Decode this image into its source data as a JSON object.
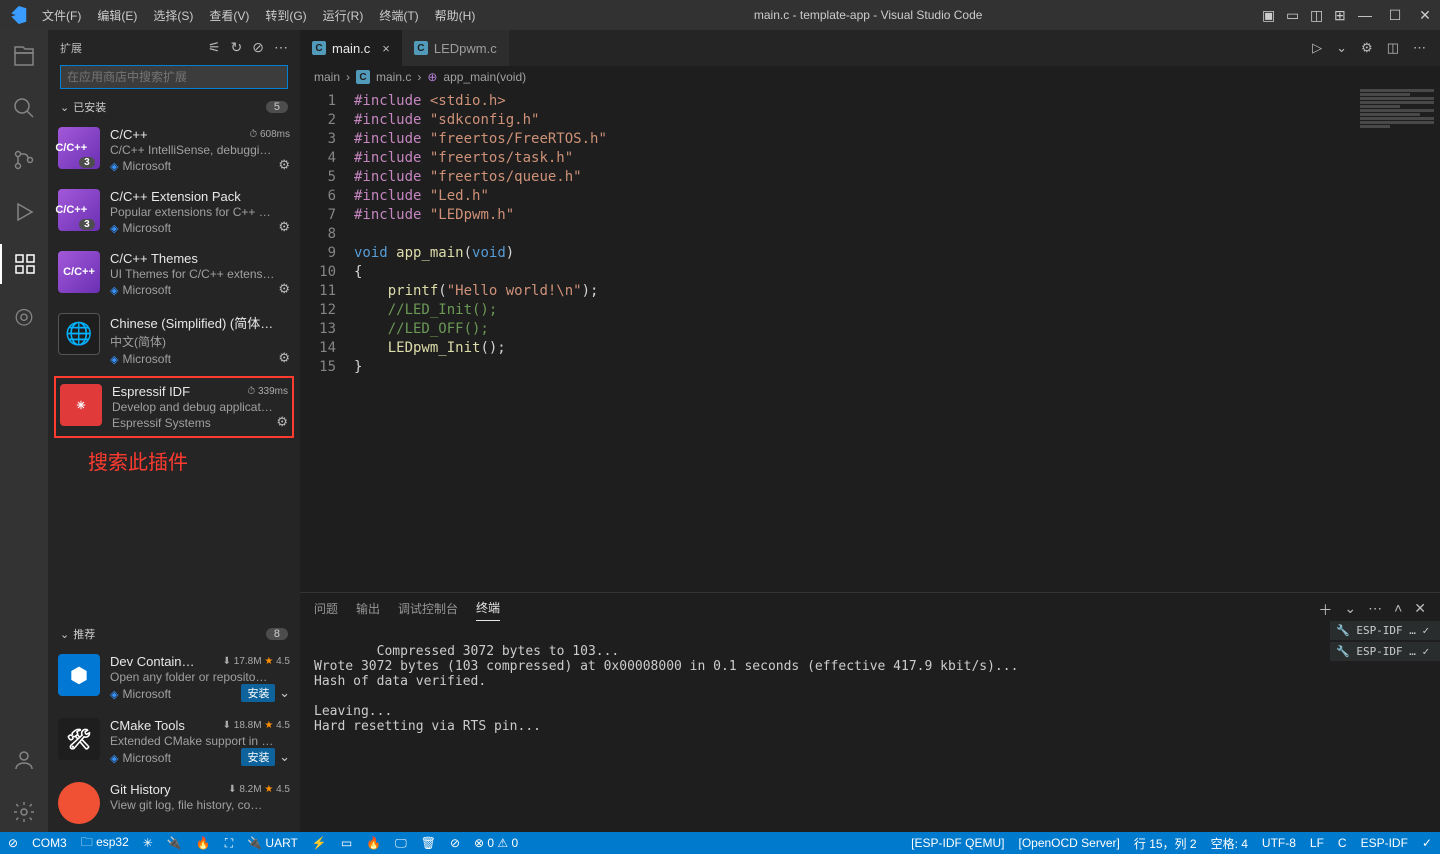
{
  "title": "main.c - template-app - Visual Studio Code",
  "menu": [
    "文件(F)",
    "编辑(E)",
    "选择(S)",
    "查看(V)",
    "转到(G)",
    "运行(R)",
    "终端(T)",
    "帮助(H)"
  ],
  "sidebar": {
    "header": "扩展",
    "searchPlaceholder": "在应用商店中搜索扩展",
    "installed": {
      "label": "已安装",
      "count": "5"
    },
    "recommended": {
      "label": "推荐",
      "count": "8"
    },
    "items": [
      {
        "name": "C/C++",
        "meta": "⏱ 608ms",
        "desc": "C/C++ IntelliSense, debuggi…",
        "pub": "Microsoft",
        "verified": true,
        "iconClass": "cpp",
        "iconText": "C/C++",
        "gear": true,
        "badge": "3"
      },
      {
        "name": "C/C++ Extension Pack",
        "meta": "",
        "desc": "Popular extensions for C++ …",
        "pub": "Microsoft",
        "verified": true,
        "iconClass": "cpp",
        "iconText": "C/C++",
        "gear": true,
        "badge": "3"
      },
      {
        "name": "C/C++ Themes",
        "meta": "",
        "desc": "UI Themes for C/C++ extens…",
        "pub": "Microsoft",
        "verified": true,
        "iconClass": "cpp",
        "iconText": "C/C++",
        "gear": true
      },
      {
        "name": "Chinese (Simplified) (简体…",
        "meta": "",
        "desc": "中文(简体)",
        "pub": "Microsoft",
        "verified": true,
        "iconClass": "cn",
        "iconText": "🌐",
        "gear": true
      },
      {
        "name": "Espressif IDF",
        "meta": "⏱ 339ms",
        "desc": "Develop and debug applicat…",
        "pub": "Espressif Systems",
        "verified": false,
        "iconClass": "esp",
        "iconText": "✳",
        "gear": true,
        "highlight": true
      }
    ],
    "annotation": "搜索此插件",
    "recs": [
      {
        "name": "Dev Contain…",
        "meta": "⬇ 17.8M ★ 4.5",
        "desc": "Open any folder or reposito…",
        "pub": "Microsoft",
        "verified": true,
        "iconClass": "dev",
        "iconText": "⬢",
        "install": "安装"
      },
      {
        "name": "CMake Tools",
        "meta": "⬇ 18.8M ★ 4.5",
        "desc": "Extended CMake support in …",
        "pub": "Microsoft",
        "verified": true,
        "iconClass": "cmake",
        "iconText": "🛠",
        "install": "安装"
      },
      {
        "name": "Git History",
        "meta": "⬇ 8.2M ★ 4.5",
        "desc": "View git log, file history, co…",
        "pub": "",
        "verified": false,
        "iconClass": "git",
        "iconText": ""
      }
    ]
  },
  "tabs": [
    {
      "label": "main.c",
      "active": true,
      "close": true
    },
    {
      "label": "LEDpwm.c",
      "active": false,
      "close": false
    }
  ],
  "crumbs": [
    "main",
    "main.c",
    "app_main(void)"
  ],
  "code": {
    "lines": [
      {
        "n": 1,
        "html": "<span class='kw'>#include</span> <span class='st'>&lt;stdio.h&gt;</span>"
      },
      {
        "n": 2,
        "html": "<span class='kw'>#include</span> <span class='st'>\"sdkconfig.h\"</span>"
      },
      {
        "n": 3,
        "html": "<span class='kw'>#include</span> <span class='st'>\"freertos/FreeRTOS.h\"</span>"
      },
      {
        "n": 4,
        "html": "<span class='kw'>#include</span> <span class='st'>\"freertos/task.h\"</span>"
      },
      {
        "n": 5,
        "html": "<span class='kw'>#include</span> <span class='st'>\"freertos/queue.h\"</span>"
      },
      {
        "n": 6,
        "html": "<span class='kw'>#include</span> <span class='st'>\"Led.h\"</span>"
      },
      {
        "n": 7,
        "html": "<span class='kw'>#include</span> <span class='st'>\"LEDpwm.h\"</span>"
      },
      {
        "n": 8,
        "html": ""
      },
      {
        "n": 9,
        "html": "<span class='ty'>void</span> <span class='fn'>app_main</span><span class='pn'>(</span><span class='ty'>void</span><span class='pn'>)</span>"
      },
      {
        "n": 10,
        "html": "<span class='pn'>{</span>"
      },
      {
        "n": 11,
        "html": "    <span class='fn'>printf</span><span class='pn'>(</span><span class='st'>\"Hello world!\\n\"</span><span class='pn'>);</span>"
      },
      {
        "n": 12,
        "html": "    <span class='cm'>//LED_Init();</span>"
      },
      {
        "n": 13,
        "html": "    <span class='cm'>//LED_OFF();</span>"
      },
      {
        "n": 14,
        "html": "    <span class='fn'>LEDpwm_Init</span><span class='pn'>();</span>"
      },
      {
        "n": 15,
        "html": "<span class='pn'>}</span>"
      }
    ]
  },
  "panel": {
    "tabs": [
      "问题",
      "输出",
      "调试控制台",
      "终端"
    ],
    "active": 3,
    "text": "Compressed 3072 bytes to 103...\nWrote 3072 bytes (103 compressed) at 0x00008000 in 0.1 seconds (effective 417.9 kbit/s)...\nHash of data verified.\n\nLeaving...\nHard resetting via RTS pin...",
    "sideTerms": [
      "ESP-IDF … ✓",
      "ESP-IDF … ✓"
    ]
  },
  "status": {
    "left": [
      "⊘",
      "COM3",
      "🗀 esp32",
      "✳",
      "🔌",
      "🔥",
      "⛶",
      "🔌 UART",
      "⚡",
      "▭",
      "🔥",
      "🖵",
      "🗑",
      "⊘",
      "⊗ 0 ⚠ 0"
    ],
    "right": [
      "[ESP-IDF QEMU]",
      "[OpenOCD Server]",
      "行 15，列 2",
      "空格: 4",
      "UTF-8",
      "LF",
      "C",
      "ESP-IDF",
      "✓"
    ]
  }
}
